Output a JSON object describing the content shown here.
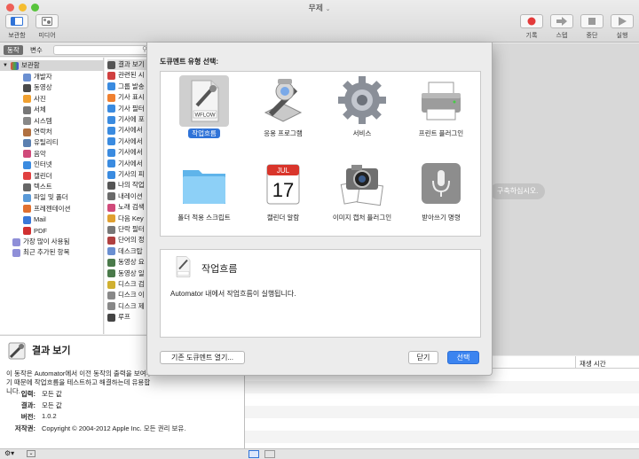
{
  "window": {
    "title": "무제"
  },
  "toolbar": {
    "left": [
      {
        "label": "보관함",
        "icon": "library-icon"
      },
      {
        "label": "미디어",
        "icon": "media-icon"
      }
    ],
    "right": [
      {
        "label": "기록",
        "icon": "record-icon"
      },
      {
        "label": "스텝",
        "icon": "step-icon"
      },
      {
        "label": "중단",
        "icon": "stop-icon"
      },
      {
        "label": "실행",
        "icon": "run-icon"
      }
    ]
  },
  "tabs": {
    "actions": "동작",
    "variables": "변수"
  },
  "library": {
    "root": "보관함",
    "items": [
      "개발자",
      "동영상",
      "사진",
      "서체",
      "시스템",
      "연락처",
      "유틸리티",
      "음악",
      "인터넷",
      "캘린더",
      "텍스트",
      "파일 및 폴더",
      "프레젠테이션",
      "Mail",
      "PDF"
    ],
    "extra": [
      "가장 많이 사용됨",
      "최근 추가된 항목"
    ]
  },
  "actions": {
    "items": [
      "결과 보기",
      "관련된 시",
      "그룹 발송",
      "기사 표시",
      "기사 필터",
      "기사에 포",
      "기사에서",
      "기사에서",
      "기사에서",
      "기사에서",
      "기사의 피",
      "나의 작업",
      "내레이션",
      "노래 검색",
      "다음 Key",
      "단락 필터",
      "단어의 정",
      "데스크탑",
      "동영상 요",
      "동영상 일",
      "디스크 검",
      "디스크 이",
      "디스크 제",
      "루프"
    ]
  },
  "description": {
    "title": "결과 보기",
    "text": "이 동작은 Automator에서 이전 동작의 출력을 보여주기 때문에 작업흐름을 테스트하고 해결하는데 유용합니다.",
    "meta": [
      {
        "key": "입력:",
        "value": "모든 값"
      },
      {
        "key": "결과:",
        "value": "모든 값"
      },
      {
        "key": "버전:",
        "value": "1.0.2"
      },
      {
        "key": "저작권:",
        "value": "Copyright © 2004-2012 Apple Inc.  모든 권리 보유."
      }
    ]
  },
  "workflow": {
    "hint": "구축하십시오.",
    "log_column": "재생 시간"
  },
  "sheet": {
    "title": "도큐멘트 유형 선택:",
    "types": [
      {
        "label": "작업흐름",
        "icon": "workflow-icon",
        "selected": true
      },
      {
        "label": "응용 프로그램",
        "icon": "application-robot-icon",
        "selected": false
      },
      {
        "label": "서비스",
        "icon": "service-gear-icon",
        "selected": false
      },
      {
        "label": "프린트 플러그인",
        "icon": "printer-icon",
        "selected": false
      },
      {
        "label": "폴더 적용 스크립트",
        "icon": "folder-icon",
        "selected": false
      },
      {
        "label": "캘린더 알람",
        "icon": "calendar-icon",
        "selected": false
      },
      {
        "label": "이미지 캡처 플러그인",
        "icon": "image-capture-icon",
        "selected": false
      },
      {
        "label": "받아쓰기 명령",
        "icon": "microphone-icon",
        "selected": false
      }
    ],
    "workflow_badge": "WFLOW",
    "calendar_month": "JUL",
    "calendar_day": "17",
    "info_title": "작업흐름",
    "info_text": "Automator 내에서 작업흐름이 실행됩니다.",
    "open_existing": "기존 도큐멘트 열기...",
    "close": "닫기",
    "choose": "선택"
  }
}
